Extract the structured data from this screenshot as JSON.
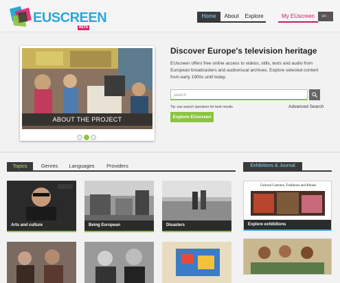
{
  "brand": {
    "name": "EUSCREEN",
    "badge": "BETA"
  },
  "nav": {
    "home": "Home",
    "about": "About",
    "explore": "Explore",
    "my": "My EUscreen",
    "lang": "en"
  },
  "hero": {
    "slide_caption": "ABOUT THE PROJECT",
    "slide_index": 2,
    "slide_count": 3,
    "title": "Discover Europe's television heritage",
    "text": "EUscreen offers free online access to videos, stills, texts and audio from European broadcasters and audiovisual archives. Explore selected content from early 1900s until today.",
    "search_placeholder": "search",
    "tip": "Tip: use search operators for best results.",
    "advanced": "Advanced Search",
    "explore_btn": "Explore EUscreen"
  },
  "tabs": [
    "Topics",
    "Genres",
    "Languages",
    "Providers"
  ],
  "active_tab": "Topics",
  "topics": [
    "Arts and culture",
    "Being European",
    "Disasters"
  ],
  "side": {
    "tab": "Exhibitions & Journal",
    "exh_header": "Cultural Customs, Traditions and Rituals",
    "exh_label": "Explore exhibitions"
  },
  "colors": {
    "accent_green": "#8bc43f",
    "accent_blue": "#3aa6dc",
    "accent_pink": "#c61a63",
    "dark": "#3a3a3a"
  }
}
